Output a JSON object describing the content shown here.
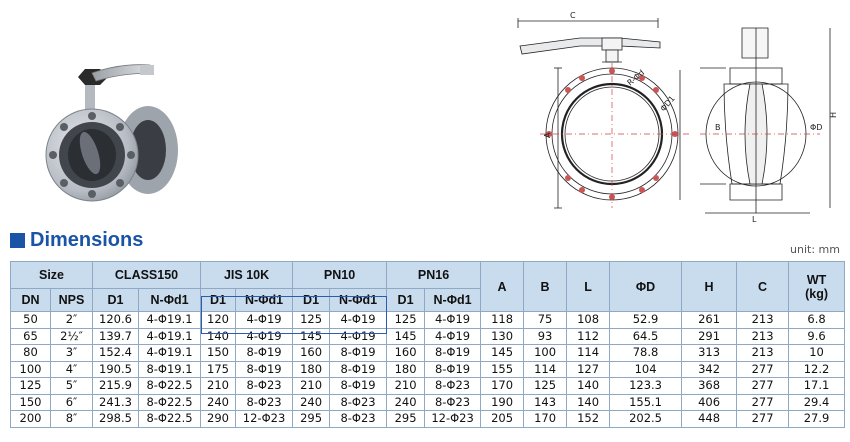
{
  "top_banner_text": "",
  "section_heading": "Dimensions",
  "unit_label": "unit: mm",
  "drawing_labels": {
    "c": "C",
    "rphi": "R-Φd",
    "a": "A",
    "phid1": "ΦD1",
    "h": "H",
    "b": "B",
    "l": "L",
    "phid": "ΦD"
  },
  "table": {
    "group_headers": {
      "size": "Size",
      "class150": "CLASS150",
      "jis10k": "JIS 10K",
      "pn10": "PN10",
      "pn16": "PN16",
      "a": "A",
      "b": "B",
      "l": "L",
      "phid": "ΦD",
      "h": "H",
      "c": "C",
      "wt": "WT",
      "wt_unit": "(kg)"
    },
    "sub_headers": {
      "dn": "DN",
      "nps": "NPS",
      "c150_d1": "D1",
      "c150_nd": "N-Φd1",
      "jis_d1": "D1",
      "jis_nd": "N-Φd1",
      "pn10_d1": "D1",
      "pn10_nd": "N-Φd1",
      "pn16_d1": "D1",
      "pn16_nd": "N-Φd1"
    },
    "rows": [
      {
        "dn": "50",
        "nps": "2″",
        "c150_d1": "120.6",
        "c150_nd": "4-Φ19.1",
        "jis_d1": "120",
        "jis_nd": "4-Φ19",
        "pn10_d1": "125",
        "pn10_nd": "4-Φ19",
        "pn16_d1": "125",
        "pn16_nd": "4-Φ19",
        "a": "118",
        "b": "75",
        "l": "108",
        "phid": "52.9",
        "h": "261",
        "c": "213",
        "wt": "6.8"
      },
      {
        "dn": "65",
        "nps": "2½″",
        "c150_d1": "139.7",
        "c150_nd": "4-Φ19.1",
        "jis_d1": "140",
        "jis_nd": "4-Φ19",
        "pn10_d1": "145",
        "pn10_nd": "4-Φ19",
        "pn16_d1": "145",
        "pn16_nd": "4-Φ19",
        "a": "130",
        "b": "93",
        "l": "112",
        "phid": "64.5",
        "h": "291",
        "c": "213",
        "wt": "9.6"
      },
      {
        "dn": "80",
        "nps": "3″",
        "c150_d1": "152.4",
        "c150_nd": "4-Φ19.1",
        "jis_d1": "150",
        "jis_nd": "8-Φ19",
        "pn10_d1": "160",
        "pn10_nd": "8-Φ19",
        "pn16_d1": "160",
        "pn16_nd": "8-Φ19",
        "a": "145",
        "b": "100",
        "l": "114",
        "phid": "78.8",
        "h": "313",
        "c": "213",
        "wt": "10"
      },
      {
        "dn": "100",
        "nps": "4″",
        "c150_d1": "190.5",
        "c150_nd": "8-Φ19.1",
        "jis_d1": "175",
        "jis_nd": "8-Φ19",
        "pn10_d1": "180",
        "pn10_nd": "8-Φ19",
        "pn16_d1": "180",
        "pn16_nd": "8-Φ19",
        "a": "155",
        "b": "114",
        "l": "127",
        "phid": "104",
        "h": "342",
        "c": "277",
        "wt": "12.2"
      },
      {
        "dn": "125",
        "nps": "5″",
        "c150_d1": "215.9",
        "c150_nd": "8-Φ22.5",
        "jis_d1": "210",
        "jis_nd": "8-Φ23",
        "pn10_d1": "210",
        "pn10_nd": "8-Φ19",
        "pn16_d1": "210",
        "pn16_nd": "8-Φ23",
        "a": "170",
        "b": "125",
        "l": "140",
        "phid": "123.3",
        "h": "368",
        "c": "277",
        "wt": "17.1"
      },
      {
        "dn": "150",
        "nps": "6″",
        "c150_d1": "241.3",
        "c150_nd": "8-Φ22.5",
        "jis_d1": "240",
        "jis_nd": "8-Φ23",
        "pn10_d1": "240",
        "pn10_nd": "8-Φ23",
        "pn16_d1": "240",
        "pn16_nd": "8-Φ23",
        "a": "190",
        "b": "143",
        "l": "140",
        "phid": "155.1",
        "h": "406",
        "c": "277",
        "wt": "29.4"
      },
      {
        "dn": "200",
        "nps": "8″",
        "c150_d1": "298.5",
        "c150_nd": "8-Φ22.5",
        "jis_d1": "290",
        "jis_nd": "12-Φ23",
        "pn10_d1": "295",
        "pn10_nd": "8-Φ23",
        "pn16_d1": "295",
        "pn16_nd": "12-Φ23",
        "a": "205",
        "b": "170",
        "l": "152",
        "phid": "202.5",
        "h": "448",
        "c": "277",
        "wt": "27.9"
      }
    ]
  },
  "colors": {
    "accent": "#1a54a6",
    "header_bg": "#c9dcee",
    "border": "#8fa8c4",
    "jis_highlight": "#2a5db0",
    "centerline": "#d04040"
  }
}
